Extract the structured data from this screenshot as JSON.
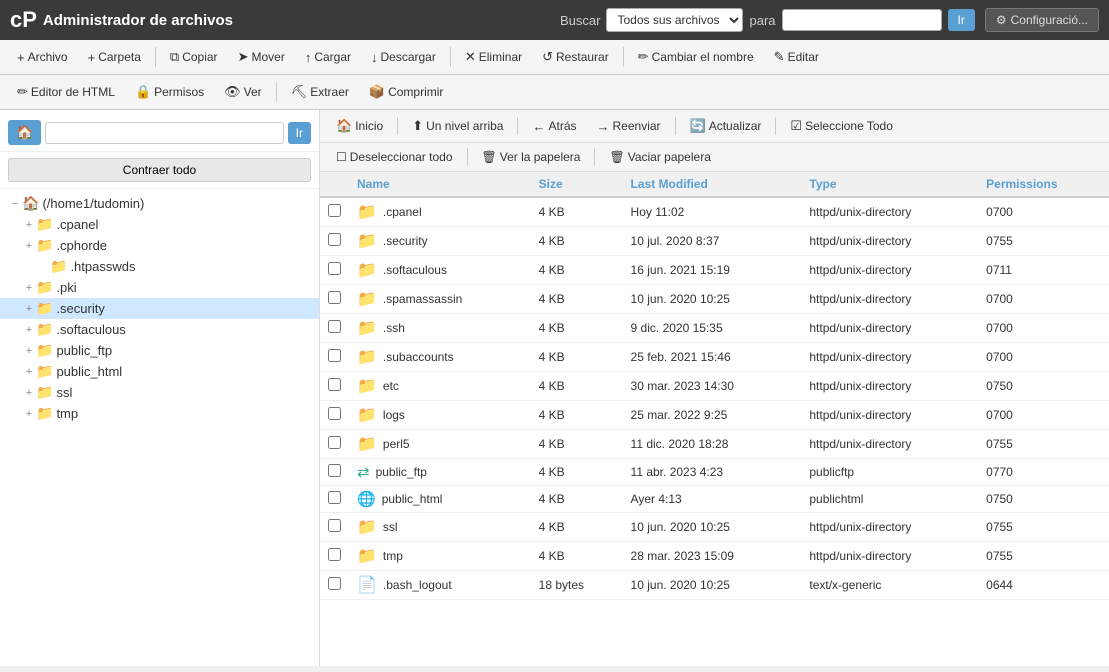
{
  "topbar": {
    "logo": "cP",
    "title": "Administrador de archivos",
    "search_label": "Buscar",
    "search_select_options": [
      "Todos sus archivos"
    ],
    "search_para": "para",
    "search_placeholder": "",
    "btn_ir": "Ir",
    "btn_config": "Configuració..."
  },
  "toolbar1": {
    "buttons": [
      {
        "id": "archivo",
        "icon": "+",
        "label": "Archivo"
      },
      {
        "id": "carpeta",
        "icon": "+",
        "label": "Carpeta"
      },
      {
        "id": "copiar",
        "icon": "⧉",
        "label": "Copiar"
      },
      {
        "id": "mover",
        "icon": "➤",
        "label": "Mover"
      },
      {
        "id": "cargar",
        "icon": "↑",
        "label": "Cargar"
      },
      {
        "id": "descargar",
        "icon": "↓",
        "label": "Descargar"
      },
      {
        "id": "eliminar",
        "icon": "✕",
        "label": "Eliminar"
      },
      {
        "id": "restaurar",
        "icon": "↺",
        "label": "Restaurar"
      },
      {
        "id": "cambiar_nombre",
        "icon": "✏",
        "label": "Cambiar el nombre"
      },
      {
        "id": "editar",
        "icon": "✎",
        "label": "Editar"
      }
    ]
  },
  "toolbar2": {
    "buttons": [
      {
        "id": "editor_html",
        "icon": "✏",
        "label": "Editor de HTML"
      },
      {
        "id": "permisos",
        "icon": "🔒",
        "label": "Permisos"
      },
      {
        "id": "ver",
        "icon": "👁",
        "label": "Ver"
      },
      {
        "id": "extraer",
        "icon": "⛏",
        "label": "Extraer"
      },
      {
        "id": "comprimir",
        "icon": "📦",
        "label": "Comprimir"
      }
    ]
  },
  "sidebar": {
    "path_placeholder": "",
    "btn_go": "Ir",
    "btn_collapse": "Contraer todo",
    "root": {
      "label": "(/home1/tudomin)",
      "icon": "🏠"
    },
    "tree": [
      {
        "id": "cpanel",
        "label": ".cpanel",
        "indent": 2,
        "toggle": "+",
        "expanded": false
      },
      {
        "id": "cphorde",
        "label": ".cphorde",
        "indent": 2,
        "toggle": "+",
        "expanded": false
      },
      {
        "id": "htpasswds",
        "label": ".htpasswds",
        "indent": 3,
        "toggle": "",
        "expanded": false
      },
      {
        "id": "pki",
        "label": ".pki",
        "indent": 2,
        "toggle": "+",
        "expanded": false
      },
      {
        "id": "security",
        "label": ".security",
        "indent": 2,
        "toggle": "+",
        "expanded": false,
        "selected": true
      },
      {
        "id": "softaculous",
        "label": ".softaculous",
        "indent": 2,
        "toggle": "+",
        "expanded": false
      },
      {
        "id": "public_ftp",
        "label": "public_ftp",
        "indent": 2,
        "toggle": "+",
        "expanded": false
      },
      {
        "id": "public_html",
        "label": "public_html",
        "indent": 2,
        "toggle": "+",
        "expanded": false
      },
      {
        "id": "ssl",
        "label": "ssl",
        "indent": 2,
        "toggle": "+",
        "expanded": false
      },
      {
        "id": "tmp",
        "label": "tmp",
        "indent": 2,
        "toggle": "+",
        "expanded": false
      }
    ]
  },
  "filepanel": {
    "nav_buttons": [
      {
        "id": "inicio",
        "icon": "🏠",
        "label": "Inicio"
      },
      {
        "id": "un_nivel",
        "icon": "⬆",
        "label": "Un nivel arriba"
      },
      {
        "id": "atras",
        "icon": "←",
        "label": "Atrás"
      },
      {
        "id": "reenviar",
        "icon": "→",
        "label": "Reenviar"
      },
      {
        "id": "actualizar",
        "icon": "🔄",
        "label": "Actualizar"
      },
      {
        "id": "sel_todo",
        "icon": "☑",
        "label": "Seleccione Todo"
      }
    ],
    "sel_buttons": [
      {
        "id": "desel_todo",
        "icon": "☐",
        "label": "Deseleccionar todo"
      },
      {
        "id": "ver_papelera",
        "icon": "🗑",
        "label": "Ver la papelera"
      },
      {
        "id": "vaciar_papelera",
        "icon": "🗑",
        "label": "Vaciar papelera"
      }
    ],
    "columns": [
      "Name",
      "Size",
      "Last Modified",
      "Type",
      "Permissions"
    ],
    "files": [
      {
        "name": ".cpanel",
        "size": "4 KB",
        "modified": "Hoy 11:02",
        "type": "httpd/unix-directory",
        "perms": "0700",
        "icon": "folder"
      },
      {
        "name": ".security",
        "size": "4 KB",
        "modified": "10 jul. 2020 8:37",
        "type": "httpd/unix-directory",
        "perms": "0755",
        "icon": "folder"
      },
      {
        "name": ".softaculous",
        "size": "4 KB",
        "modified": "16 jun. 2021 15:19",
        "type": "httpd/unix-directory",
        "perms": "0711",
        "icon": "folder"
      },
      {
        "name": ".spamassassin",
        "size": "4 KB",
        "modified": "10 jun. 2020 10:25",
        "type": "httpd/unix-directory",
        "perms": "0700",
        "icon": "folder"
      },
      {
        "name": ".ssh",
        "size": "4 KB",
        "modified": "9 dic. 2020 15:35",
        "type": "httpd/unix-directory",
        "perms": "0700",
        "icon": "folder"
      },
      {
        "name": ".subaccounts",
        "size": "4 KB",
        "modified": "25 feb. 2021 15:46",
        "type": "httpd/unix-directory",
        "perms": "0700",
        "icon": "folder"
      },
      {
        "name": "etc",
        "size": "4 KB",
        "modified": "30 mar. 2023 14:30",
        "type": "httpd/unix-directory",
        "perms": "0750",
        "icon": "folder"
      },
      {
        "name": "logs",
        "size": "4 KB",
        "modified": "25 mar. 2022 9:25",
        "type": "httpd/unix-directory",
        "perms": "0700",
        "icon": "folder"
      },
      {
        "name": "perl5",
        "size": "4 KB",
        "modified": "11 dic. 2020 18:28",
        "type": "httpd/unix-directory",
        "perms": "0755",
        "icon": "folder"
      },
      {
        "name": "public_ftp",
        "size": "4 KB",
        "modified": "11 abr. 2023 4:23",
        "type": "publicftp",
        "perms": "0770",
        "icon": "link"
      },
      {
        "name": "public_html",
        "size": "4 KB",
        "modified": "Ayer 4:13",
        "type": "publichtml",
        "perms": "0750",
        "icon": "globe"
      },
      {
        "name": "ssl",
        "size": "4 KB",
        "modified": "10 jun. 2020 10:25",
        "type": "httpd/unix-directory",
        "perms": "0755",
        "icon": "folder"
      },
      {
        "name": "tmp",
        "size": "4 KB",
        "modified": "28 mar. 2023 15:09",
        "type": "httpd/unix-directory",
        "perms": "0755",
        "icon": "folder"
      },
      {
        "name": ".bash_logout",
        "size": "18 bytes",
        "modified": "10 jun. 2020 10:25",
        "type": "text/x-generic",
        "perms": "0644",
        "icon": "file"
      }
    ]
  }
}
